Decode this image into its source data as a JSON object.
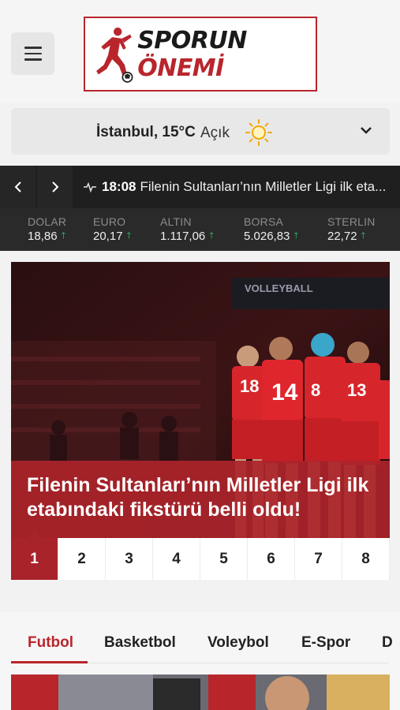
{
  "header": {
    "logo_word1": "SPORUN",
    "logo_word2": "ÖNEMİ"
  },
  "weather": {
    "city_temp": "İstanbul, 15°C",
    "condition": "Açık"
  },
  "ticker": {
    "time": "18:08",
    "headline": "Filenin Sultanları’nın Milletler Ligi ilk eta..."
  },
  "markets": [
    {
      "name": "DOLAR",
      "value": "18,86"
    },
    {
      "name": "EURO",
      "value": "20,17"
    },
    {
      "name": "ALTIN",
      "value": "1.117,06"
    },
    {
      "name": "BORSA",
      "value": "5.026,83"
    },
    {
      "name": "STERLIN",
      "value": "22,72"
    }
  ],
  "slider": {
    "headline": "Filenin Sultanları’nın Milletler Ligi ilk etabındaki fikstürü belli oldu!",
    "photo_banner": "VOLLEYBALL",
    "pages": [
      "1",
      "2",
      "3",
      "4",
      "5",
      "6",
      "7",
      "8"
    ],
    "active_page": "1"
  },
  "categories": {
    "tabs": [
      "Futbol",
      "Basketbol",
      "Voleybol",
      "E-Spor",
      "D"
    ],
    "active": "Futbol"
  },
  "colors": {
    "brand_red": "#b8262c",
    "ticker_bg": "#1f1f1f",
    "up_arrow": "#2ecc71"
  }
}
